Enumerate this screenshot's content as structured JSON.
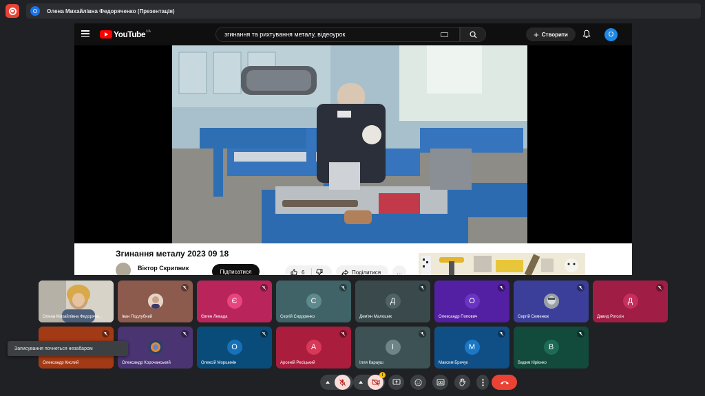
{
  "presentation": {
    "presenter_initial": "О",
    "presenter_label": "Олена Михайлівна Федоряченко (Презентація)"
  },
  "youtube": {
    "logo_text": "YouTube",
    "logo_region": "UA",
    "search_value": "згинання та рихтування металу, відеоурок",
    "create_label": "Створити",
    "account_initial": "О",
    "video_title": "Згинання металу 2023 09 18",
    "channel_name": "Віктор Скрипник",
    "subscribe_label": "Підписатися",
    "like_count": "6",
    "share_label": "Поділитися",
    "more_label": "..."
  },
  "participants": [
    {
      "name": "Олена Михайлівна Федоряче...",
      "initial": "",
      "tile_color": "#c9c0b0",
      "avatar_color": "",
      "has_photo": true
    },
    {
      "name": "Іван Подлубний",
      "initial": "",
      "tile_color": "#8d5a4e",
      "avatar_color": "#f0d9c8",
      "has_photo": true
    },
    {
      "name": "Євген Левада",
      "initial": "Є",
      "tile_color": "#b9255b",
      "avatar_color": "#e8457e"
    },
    {
      "name": "Сергій Сидоренко",
      "initial": "С",
      "tile_color": "#3f6367",
      "avatar_color": "#5e8a8e"
    },
    {
      "name": "Дем'ян Малошик",
      "initial": "Д",
      "tile_color": "#3a4a4c",
      "avatar_color": "#4f6264"
    },
    {
      "name": "Олександр Попович",
      "initial": "О",
      "tile_color": "#5320a3",
      "avatar_color": "#6a34c2"
    },
    {
      "name": "Сергій Семенюк",
      "initial": "",
      "tile_color": "#3c3f99",
      "avatar_color": "#8b8f9a",
      "has_photo": true
    },
    {
      "name": "Давид Рогозін",
      "initial": "Д",
      "tile_color": "#a01d45",
      "avatar_color": "#c62e5c"
    },
    {
      "name": "Олександр Кислий",
      "initial": "",
      "tile_color": "#a33a16",
      "avatar_color": "",
      "has_photo": false
    },
    {
      "name": "Олександр Корочанський",
      "initial": "",
      "tile_color": "#4a3472",
      "avatar_color": "#7a5a9e",
      "has_photo": true
    },
    {
      "name": "Олексій Моршинін",
      "initial": "О",
      "tile_color": "#0a4c79",
      "avatar_color": "#1771b8"
    },
    {
      "name": "Арсеній Ресіцький",
      "initial": "А",
      "tile_color": "#aa1d3c",
      "avatar_color": "#d63a58"
    },
    {
      "name": "Ілля Карауш",
      "initial": "І",
      "tile_color": "#3c5254",
      "avatar_color": "#6f8486"
    },
    {
      "name": "Максим Бричук",
      "initial": "М",
      "tile_color": "#104f86",
      "avatar_color": "#1a78c7"
    },
    {
      "name": "Вадим Кірієнко",
      "initial": "В",
      "tile_color": "#124a3c",
      "avatar_color": "#1d6b55"
    }
  ],
  "toast": "Записування почнеться незабаром",
  "controls": {
    "reactions_badge": "!"
  },
  "colors": {
    "background": "#202124",
    "end_call": "#ea4335",
    "mic_muted_bg": "#f9dedc",
    "youtube_red": "#ff0000"
  }
}
